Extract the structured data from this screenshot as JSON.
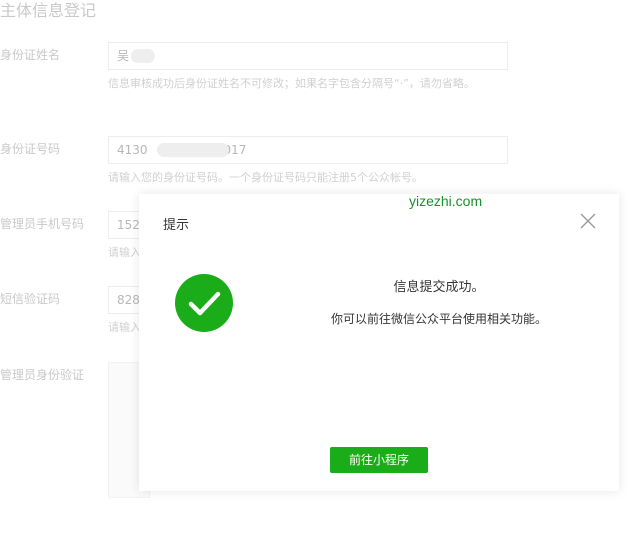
{
  "form": {
    "section_title": "主体信息登记",
    "name": {
      "label": "身份证姓名",
      "value": "吴",
      "hint": "信息审核成功后身份证姓名不可修改；如果名字包含分隔号“·”，请勿省略。"
    },
    "id_number": {
      "label": "身份证号码",
      "value_prefix": "4130",
      "value_suffix": "017",
      "hint": "请输入您的身份证号码。一个身份证号码只能注册5个公众帐号。"
    },
    "phone": {
      "label": "管理员手机号码",
      "value": "152",
      "hint": "请输入"
    },
    "sms_code": {
      "label": "短信验证码",
      "value": "828",
      "hint": "请输入"
    },
    "id_verify": {
      "label": "管理员身份验证"
    }
  },
  "dialog": {
    "title": "提示",
    "message_title": "信息提交成功。",
    "message_desc": "你可以前往微信公众平台使用相关功能。",
    "button_label": "前往小程序",
    "close_icon": "close-icon",
    "status_icon": "check-circle-icon",
    "accent_color": "#1aad19"
  },
  "watermark": "yizezhi.com"
}
